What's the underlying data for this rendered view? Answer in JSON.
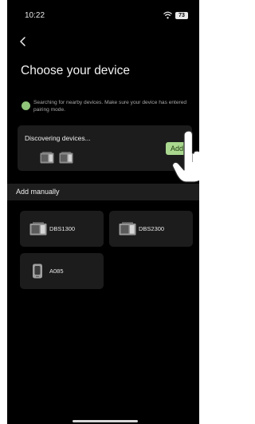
{
  "status_bar": {
    "time": "10:22",
    "battery": "73"
  },
  "page": {
    "title": "Choose your device"
  },
  "search": {
    "text": "Searching for nearby devices. Make sure your device has entered pairing mode."
  },
  "discover": {
    "label": "Discovering devices...",
    "add_label": "Add"
  },
  "manual": {
    "section_label": "Add manually",
    "devices": [
      {
        "name": "DBS1300",
        "icon": "power-station-icon"
      },
      {
        "name": "DBS2300",
        "icon": "power-station-icon"
      },
      {
        "name": "A085",
        "icon": "portable-battery-icon"
      }
    ]
  },
  "colors": {
    "accent": "#a9d88e",
    "background": "#000000",
    "card": "#1c1c1c"
  }
}
